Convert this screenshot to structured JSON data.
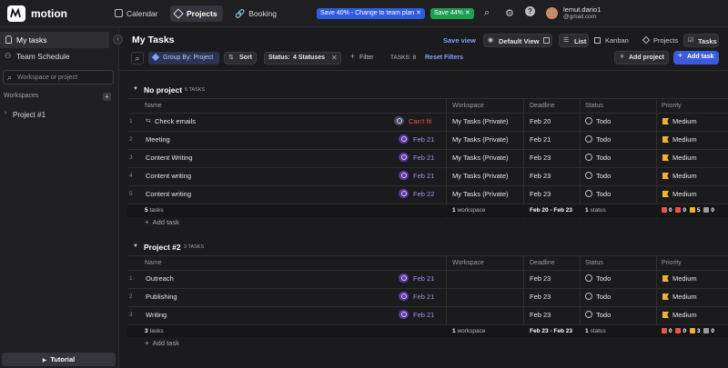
{
  "app": {
    "name": "motion"
  },
  "nav": {
    "calendar": "Calendar",
    "projects": "Projects",
    "booking": "Booking"
  },
  "promos": {
    "team": "Save 40% - Change to team plan",
    "save": "Save 44%"
  },
  "user": {
    "name": "lemut.dario1",
    "email": "@gmail.com"
  },
  "sidebar": {
    "my_tasks": "My tasks",
    "team_schedule": "Team Schedule",
    "search_placeholder": "Workspace or project",
    "workspaces": "Workspaces",
    "project1": "Project #1",
    "tutorial": "Tutorial"
  },
  "header": {
    "title": "My Tasks",
    "save_view": "Save view",
    "default_view": "Default View",
    "list": "List",
    "kanban": "Kanban",
    "projects": "Projects",
    "tasks": "Tasks"
  },
  "toolbar": {
    "group_by": "Group By: Project",
    "sort": "Sort",
    "status_label": "Status:",
    "status_value": "4 Statuses",
    "filter": "Filter",
    "tasks_count": "TASKS: 8",
    "reset": "Reset Filters",
    "add_project": "Add project",
    "add_task": "Add task"
  },
  "columns": {
    "name": "Name",
    "workspace": "Workspace",
    "deadline": "Deadline",
    "status": "Status",
    "priority": "Priority"
  },
  "groups": [
    {
      "title": "No project",
      "count": "5 TASKS",
      "rows": [
        {
          "idx": "1",
          "name": "Check emails",
          "date": "Can't fit",
          "workspace": "My Tasks (Private)",
          "deadline": "Feb 20",
          "status": "Todo",
          "priority": "Medium"
        },
        {
          "idx": "2",
          "name": "Meeting",
          "date": "Feb 21",
          "workspace": "My Tasks (Private)",
          "deadline": "Feb 21",
          "status": "Todo",
          "priority": "Medium"
        },
        {
          "idx": "3",
          "name": "Content Writing",
          "date": "Feb 21",
          "workspace": "My Tasks (Private)",
          "deadline": "Feb 23",
          "status": "Todo",
          "priority": "Medium"
        },
        {
          "idx": "4",
          "name": "Content writing",
          "date": "Feb 21",
          "workspace": "My Tasks (Private)",
          "deadline": "Feb 23",
          "status": "Todo",
          "priority": "Medium"
        },
        {
          "idx": "5",
          "name": "Content writing",
          "date": "Feb 22",
          "workspace": "My Tasks (Private)",
          "deadline": "Feb 23",
          "status": "Todo",
          "priority": "Medium"
        }
      ],
      "footer": {
        "tasks_n": "5",
        "tasks_word": "tasks",
        "ws_n": "1",
        "ws_word": "workspace",
        "range": "Feb 20 - Feb 23",
        "st_n": "1",
        "st_word": "status",
        "p1": "0",
        "p2": "0",
        "p3": "5",
        "p4": "0"
      },
      "add_task": "Add task"
    },
    {
      "title": "Project #2",
      "count": "3 TASKS",
      "rows": [
        {
          "idx": "1",
          "name": "Outreach",
          "date": "Feb 21",
          "workspace": "",
          "deadline": "Feb 23",
          "status": "Todo",
          "priority": "Medium"
        },
        {
          "idx": "2",
          "name": "Publishing",
          "date": "Feb 21",
          "workspace": "",
          "deadline": "Feb 23",
          "status": "Todo",
          "priority": "Medium"
        },
        {
          "idx": "3",
          "name": "Writing",
          "date": "Feb 21",
          "workspace": "",
          "deadline": "Feb 23",
          "status": "Todo",
          "priority": "Medium"
        }
      ],
      "footer": {
        "tasks_n": "3",
        "tasks_word": "tasks",
        "ws_n": "1",
        "ws_word": "workspace",
        "range": "Feb 23 - Feb 23",
        "st_n": "1",
        "st_word": "status",
        "p1": "0",
        "p2": "0",
        "p3": "3",
        "p4": "0"
      },
      "add_task": "Add task"
    }
  ],
  "colors": {
    "accent": "#3b5bdb",
    "promo_blue": "#2f5be0",
    "promo_green": "#1f9d55",
    "cant_fit": "#e8544a",
    "date_purple": "#a88bf2",
    "medium_flag": "#f2b02e"
  }
}
